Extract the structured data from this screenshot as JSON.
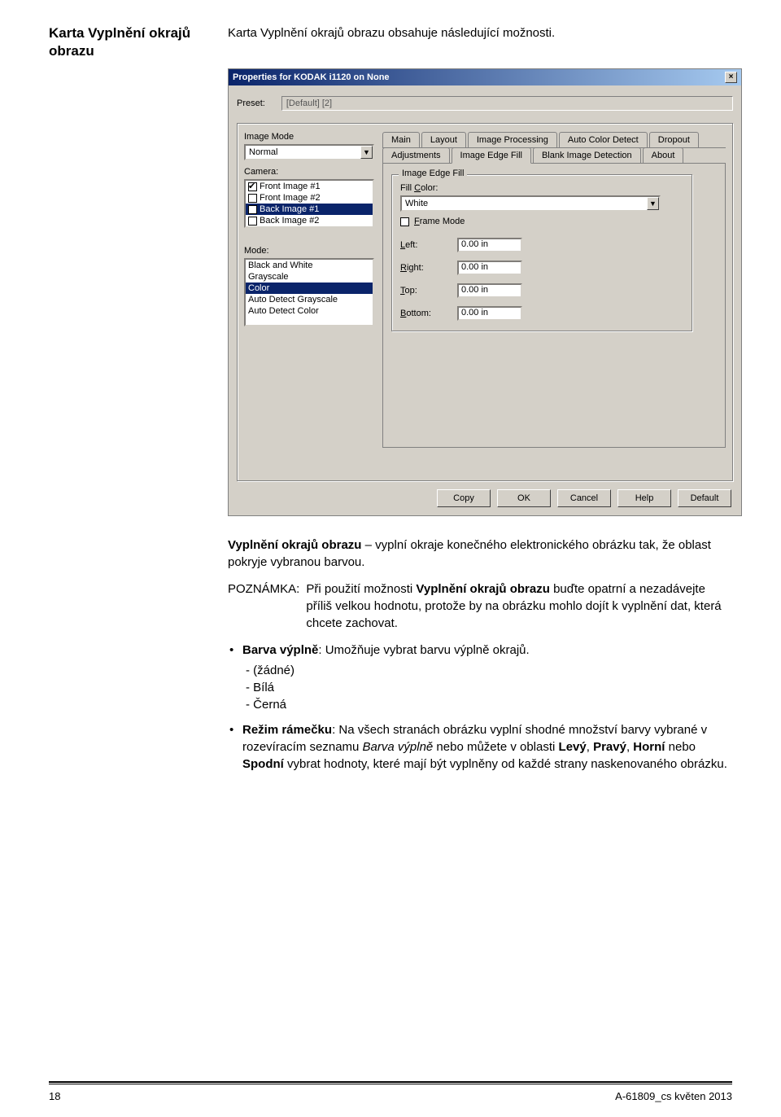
{
  "heading": "Karta Vyplnění okrajů obrazu",
  "intro": "Karta Vyplnění okrajů obrazu obsahuje následující možnosti.",
  "dialog": {
    "title": "Properties for KODAK i1120 on None",
    "preset_label": "Preset:",
    "preset_value": "[Default] [2]",
    "image_mode_label": "Image Mode",
    "image_mode_value": "Normal",
    "camera_label": "Camera:",
    "camera_items": [
      {
        "t": "Front Image #1",
        "checked": true,
        "sel": false
      },
      {
        "t": "Front Image #2",
        "checked": false,
        "sel": false
      },
      {
        "t": "Back Image #1",
        "checked": false,
        "sel": true
      },
      {
        "t": "Back Image #2",
        "checked": false,
        "sel": false
      }
    ],
    "mode_label": "Mode:",
    "mode_items": [
      {
        "t": "Black and White",
        "sel": false
      },
      {
        "t": "Grayscale",
        "sel": false
      },
      {
        "t": "Color",
        "sel": true
      },
      {
        "t": "Auto Detect Grayscale",
        "sel": false
      },
      {
        "t": "Auto Detect Color",
        "sel": false
      }
    ],
    "tabs_row1": [
      "Main",
      "Layout",
      "Image Processing",
      "Auto Color Detect",
      "Dropout"
    ],
    "tabs_row2": [
      "Adjustments",
      "Image Edge Fill",
      "Blank Image Detection",
      "About"
    ],
    "active_tab": "Image Edge Fill",
    "edgefill": {
      "legend": "Image Edge Fill",
      "fill_color_label": "Fill Color:",
      "fill_color_value": "White",
      "frame_mode_label": "Frame Mode",
      "frame_mode_checked": false,
      "left_label": "Left:",
      "left_value": "0.00 in",
      "right_label": "Right:",
      "right_value": "0.00 in",
      "top_label": "Top:",
      "top_value": "0.00 in",
      "bottom_label": "Bottom:",
      "bottom_value": "0.00 in"
    },
    "buttons": [
      "Copy",
      "OK",
      "Cancel",
      "Help",
      "Default"
    ]
  },
  "body": {
    "para1_a": "Vyplnění okrajů obrazu",
    "para1_b": " – vyplní okraje konečného elektronického obrázku tak, že oblast pokryje vybranou barvou.",
    "note_label": "POZNÁMKA:",
    "note_a": "Při použití možnosti ",
    "note_strong": "Vyplnění okrajů obrazu",
    "note_b": " buďte opatrní a nezadávejte příliš velkou hodnotu, protože by na obrázku mohlo dojít k vyplnění dat, která chcete zachovat.",
    "bullet1_strong": "Barva výplně",
    "bullet1_rest": ": Umožňuje vybrat barvu výplně okrajů.",
    "opt_none": "- (žádné)",
    "opt_white": "- Bílá",
    "opt_black": "- Černá",
    "bullet2_strong": "Režim rámečku",
    "bullet2_a": ": Na všech stranách obrázku vyplní shodné množství barvy vybrané v rozevíracím seznamu ",
    "bullet2_em": "Barva výplně",
    "bullet2_b": " nebo můžete v oblasti ",
    "b2_levy": "Levý",
    "b2_c1": ", ",
    "b2_pravy": "Pravý",
    "b2_c2": ", ",
    "b2_horni": "Horní",
    "b2_c3": " nebo ",
    "b2_spodni": "Spodní",
    "bullet2_c": " vybrat hodnoty, které mají být vyplněny od každé strany naskenovaného obrázku."
  },
  "footer": {
    "page": "18",
    "doc": "A-61809_cs  květen 2013"
  }
}
